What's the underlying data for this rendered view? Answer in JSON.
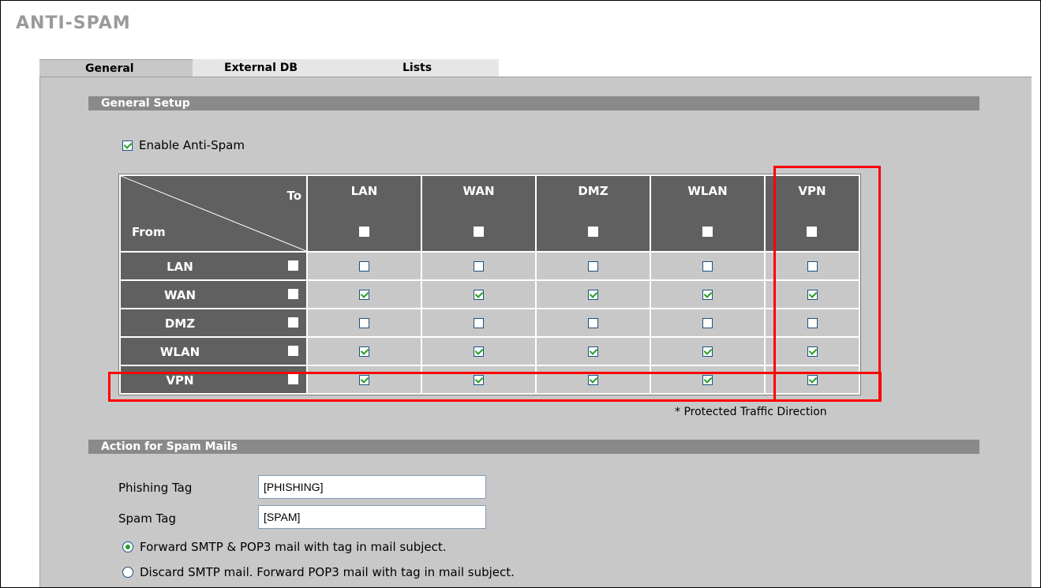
{
  "page": {
    "title": "ANTI-SPAM"
  },
  "tabs": [
    {
      "label": "General",
      "active": true
    },
    {
      "label": "External DB",
      "active": false
    },
    {
      "label": "Lists",
      "active": false
    }
  ],
  "general_setup": {
    "title": "General Setup",
    "enable_label": "Enable Anti-Spam",
    "enable_checked": true,
    "matrix": {
      "to_label": "To",
      "from_label": "From",
      "columns": [
        "LAN",
        "WAN",
        "DMZ",
        "WLAN",
        "VPN"
      ],
      "column_header_checked": [
        false,
        false,
        false,
        false,
        false
      ],
      "rows": [
        {
          "label": "LAN",
          "header_checked": false,
          "cells": [
            false,
            false,
            false,
            false,
            false
          ]
        },
        {
          "label": "WAN",
          "header_checked": false,
          "cells": [
            true,
            true,
            true,
            true,
            true
          ]
        },
        {
          "label": "DMZ",
          "header_checked": false,
          "cells": [
            false,
            false,
            false,
            false,
            false
          ]
        },
        {
          "label": "WLAN",
          "header_checked": false,
          "cells": [
            true,
            true,
            true,
            true,
            true
          ]
        },
        {
          "label": "VPN",
          "header_checked": false,
          "cells": [
            true,
            true,
            true,
            true,
            true
          ]
        }
      ]
    },
    "note": "* Protected Traffic Direction",
    "highlight_color": "#ff0000"
  },
  "spam_action": {
    "title": "Action for Spam Mails",
    "phishing_label": "Phishing Tag",
    "phishing_value": "[PHISHING]",
    "spam_label": "Spam Tag",
    "spam_value": "[SPAM]",
    "options": [
      {
        "label": "Forward SMTP & POP3 mail with tag in mail subject.",
        "selected": true
      },
      {
        "label": "Discard SMTP mail. Forward POP3 mail with tag in mail subject.",
        "selected": false
      }
    ]
  }
}
